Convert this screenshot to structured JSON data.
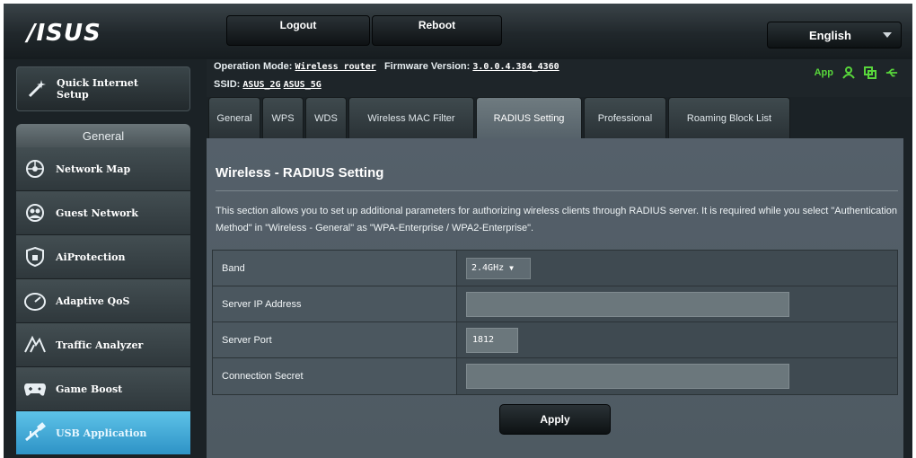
{
  "brand": {
    "logo": "/ISUS"
  },
  "topbar": {
    "logout": "Logout",
    "reboot": "Reboot",
    "language": "English"
  },
  "info": {
    "op_label": "Operation Mode:",
    "op_mode": "Wireless router",
    "fw_label": "Firmware Version:",
    "fw_version": "3.0.0.4.384_4360",
    "ssid_label": "SSID:",
    "ssid_1": "ASUS_2G",
    "ssid_2": "ASUS_5G",
    "app_label": "App"
  },
  "sidebar": {
    "quick_setup": "Quick Internet Setup",
    "section": "General",
    "items": [
      {
        "label": "Network Map",
        "icon": "network-map-icon"
      },
      {
        "label": "Guest Network",
        "icon": "guest-network-icon"
      },
      {
        "label": "AiProtection",
        "icon": "shield-icon"
      },
      {
        "label": "Adaptive QoS",
        "icon": "gauge-icon"
      },
      {
        "label": "Traffic Analyzer",
        "icon": "traffic-analyzer-icon"
      },
      {
        "label": "Game Boost",
        "icon": "gamepad-icon"
      },
      {
        "label": "USB Application",
        "icon": "usb-icon",
        "active": true
      }
    ]
  },
  "tabs": [
    {
      "label": "General"
    },
    {
      "label": "WPS"
    },
    {
      "label": "WDS"
    },
    {
      "label": "Wireless MAC Filter"
    },
    {
      "label": "RADIUS Setting",
      "active": true
    },
    {
      "label": "Professional"
    },
    {
      "label": "Roaming Block List"
    }
  ],
  "main": {
    "title": "Wireless - RADIUS Setting",
    "description": "This section allows you to set up additional parameters for authorizing wireless clients through RADIUS server. It is required while you select \"Authentication Method\" in \"Wireless - General\" as \"WPA-Enterprise / WPA2-Enterprise\".",
    "fields": {
      "band_label": "Band",
      "band_value": "2.4GHz",
      "server_ip_label": "Server IP Address",
      "server_ip_value": "",
      "server_port_label": "Server Port",
      "server_port_value": "1812",
      "secret_label": "Connection Secret",
      "secret_value": ""
    },
    "apply": "Apply"
  },
  "colors": {
    "accent": "#3aa6d8",
    "status_green": "#58d63b",
    "panel": "#55606a"
  }
}
